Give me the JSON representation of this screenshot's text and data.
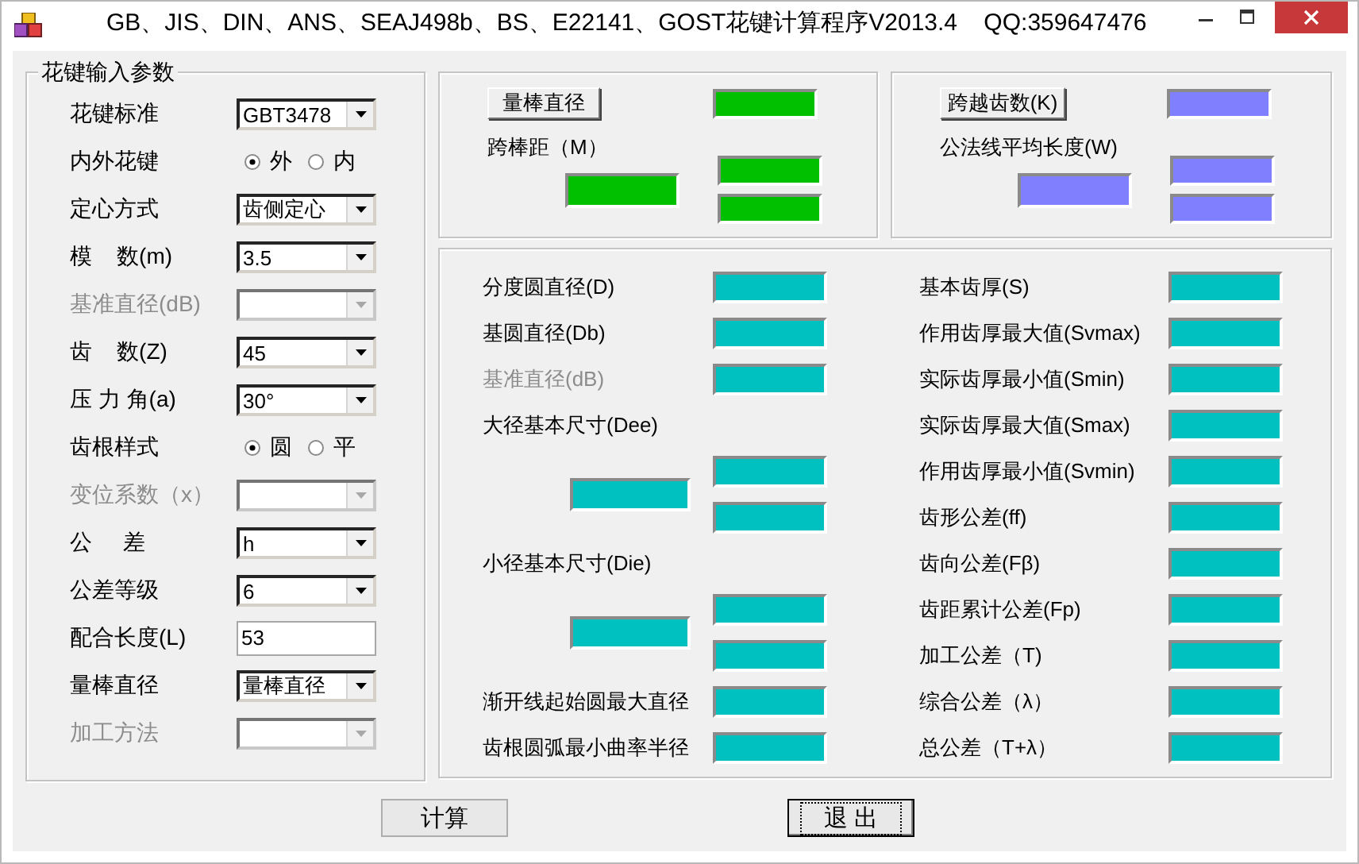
{
  "window": {
    "title": "GB、JIS、DIN、ANS、SEAJ498b、BS、E22141、GOST花键计算程序V2013.4    QQ:359647476"
  },
  "input_group": {
    "title": "花键输入参数",
    "params": [
      {
        "kind": "combo",
        "label": "花键标准",
        "value": "GBT3478",
        "disabled": false
      },
      {
        "kind": "radio",
        "label": "内外花键",
        "disabled": false,
        "options": [
          {
            "label": "外",
            "selected": true
          },
          {
            "label": "内",
            "selected": false
          }
        ]
      },
      {
        "kind": "combo",
        "label": "定心方式",
        "value": "齿侧定心",
        "disabled": false
      },
      {
        "kind": "combo",
        "label": "模    数(m)",
        "value": "3.5",
        "disabled": false
      },
      {
        "kind": "combo",
        "label": "基准直径(dB)",
        "disabled": true
      },
      {
        "kind": "combo",
        "label": "齿    数(Z)",
        "value": "45",
        "disabled": false
      },
      {
        "kind": "combo",
        "label": "压 力 角(a)",
        "value": "30°",
        "disabled": false
      },
      {
        "kind": "radio",
        "label": "齿根样式",
        "disabled": false,
        "options": [
          {
            "label": "圆",
            "selected": true
          },
          {
            "label": "平",
            "selected": false
          }
        ]
      },
      {
        "kind": "combo",
        "label": "变位系数（x）",
        "disabled": true
      },
      {
        "kind": "combo",
        "label": "公     差",
        "value": "h",
        "disabled": false
      },
      {
        "kind": "combo",
        "label": "公差等级",
        "value": "6",
        "disabled": false
      },
      {
        "kind": "text",
        "label": "配合长度(L)",
        "value": "53",
        "disabled": false
      },
      {
        "kind": "combo",
        "label": "量棒直径",
        "value": "量棒直径",
        "disabled": false
      },
      {
        "kind": "combo",
        "label": "加工方法",
        "disabled": true
      }
    ]
  },
  "measure_boxes": [
    {
      "kind": "pin",
      "button": "量棒直径",
      "label": "跨棒距（M）"
    },
    {
      "kind": "span",
      "button": "跨越齿数(K)",
      "label": "公法线平均长度(W)"
    }
  ],
  "results": {
    "columns": [
      [
        {
          "kind": "field",
          "label": "分度圆直径(D)",
          "disabled": false
        },
        {
          "kind": "field",
          "label": "基圆直径(Db)",
          "disabled": false
        },
        {
          "kind": "field",
          "label": "基准直径(dB)",
          "disabled": true
        },
        {
          "kind": "heading",
          "label": "大径基本尺寸(Dee)",
          "disabled": false
        },
        {
          "kind": "pair"
        },
        {
          "kind": "heading",
          "label": "小径基本尺寸(Die)",
          "disabled": false
        },
        {
          "kind": "pair"
        },
        {
          "kind": "field",
          "label": "渐开线起始圆最大直径",
          "disabled": false
        },
        {
          "kind": "field",
          "label": "齿根圆弧最小曲率半径",
          "disabled": false
        }
      ],
      [
        {
          "kind": "field",
          "label": "基本齿厚(S)",
          "disabled": false
        },
        {
          "kind": "field",
          "label": "作用齿厚最大值(Svmax)",
          "disabled": false
        },
        {
          "kind": "field",
          "label": "实际齿厚最小值(Smin)",
          "disabled": false
        },
        {
          "kind": "field",
          "label": "实际齿厚最大值(Smax)",
          "disabled": false
        },
        {
          "kind": "field",
          "label": "作用齿厚最小值(Svmin)",
          "disabled": false
        },
        {
          "kind": "field",
          "label": "齿形公差(ff)",
          "disabled": false
        },
        {
          "kind": "field",
          "label": "齿向公差(Fβ)",
          "disabled": false
        },
        {
          "kind": "field",
          "label": "齿距累计公差(Fp)",
          "disabled": false
        },
        {
          "kind": "field",
          "label": "加工公差（T)",
          "disabled": false
        },
        {
          "kind": "field",
          "label": "综合公差（λ）",
          "disabled": false
        },
        {
          "kind": "field",
          "label": "总公差（T+λ）",
          "disabled": false
        }
      ]
    ]
  },
  "buttons": [
    {
      "label": "计算",
      "focused": false
    },
    {
      "label": "退 出",
      "focused": true
    }
  ]
}
